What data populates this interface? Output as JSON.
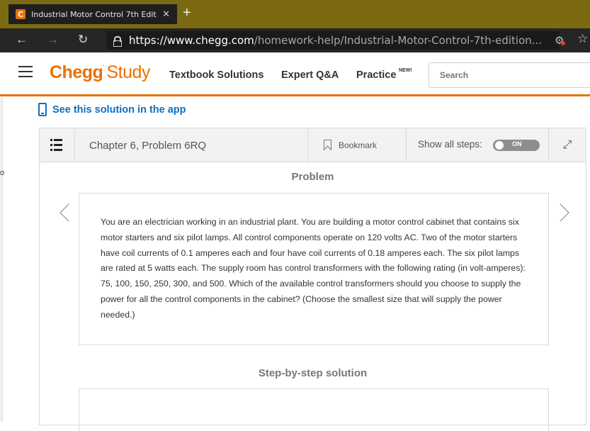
{
  "browser": {
    "tab_title": "Industrial Motor Control 7th Edit",
    "favicon_letter": "C",
    "url_host": "https://www.chegg.com",
    "url_path": "/homework-help/Industrial-Motor-Control-7th-edition..."
  },
  "header": {
    "logo_chegg": "Chegg",
    "logo_study": "Study",
    "nav": {
      "textbook": "Textbook Solutions",
      "expert": "Expert Q&A",
      "practice": "Practice",
      "practice_badge": "NEW!"
    },
    "search_placeholder": "Search"
  },
  "applink": "See this solution in the app",
  "panel": {
    "chapter": "Chapter 6, Problem 6RQ",
    "bookmark": "Bookmark",
    "show_all": "Show all steps:",
    "toggle_label": "ON",
    "problem_title": "Problem",
    "problem_text": "You are an electrician working in an industrial plant. You are building a motor control cabinet that contains six motor starters and six pilot lamps. All control components operate on 120 volts AC. Two of the motor starters have coil currents of 0.1 amperes each and four have coil currents of 0.18 amperes each. The six pilot lamps are rated at 5 watts each. The supply room has control transformers with the following rating (in volt-amperes): 75, 100, 150, 250, 300, and 500. Which of the available control transformers should you choose to supply the power for all the control components in the cabinet? (Choose the smallest size that will supply the power needed.)",
    "steps_title": "Step-by-step solution"
  },
  "colors": {
    "brand_orange": "#eb7100",
    "link_blue": "#0e6fc1"
  }
}
